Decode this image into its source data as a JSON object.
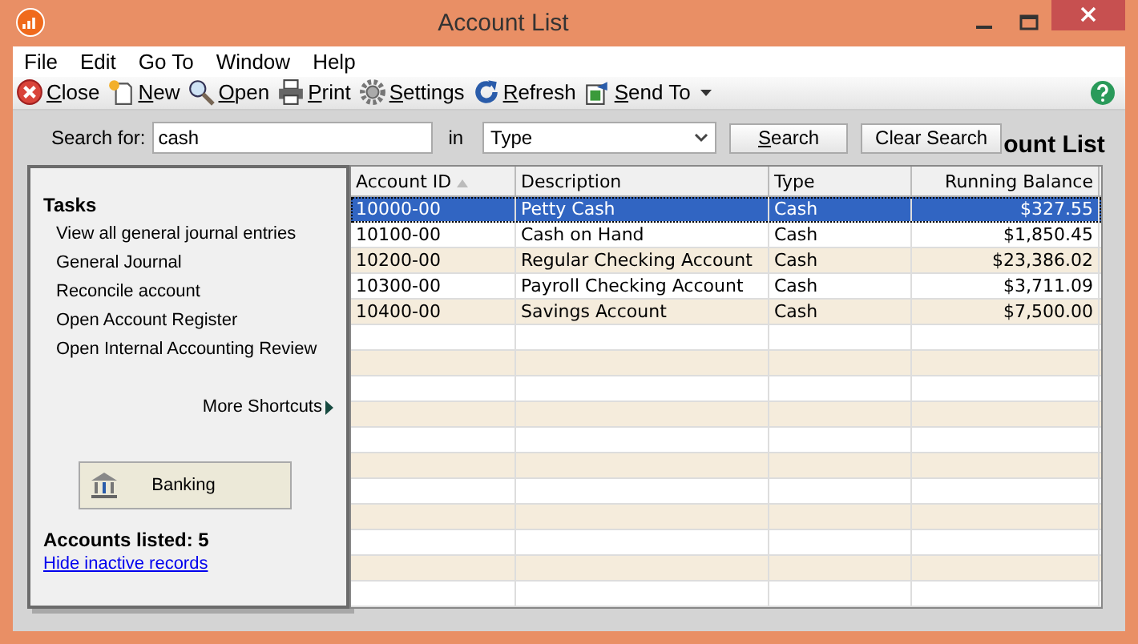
{
  "window": {
    "title": "Account List"
  },
  "menu": [
    "File",
    "Edit",
    "Go To",
    "Window",
    "Help"
  ],
  "toolbar": [
    "Close",
    "New",
    "Open",
    "Print",
    "Settings",
    "Refresh",
    "Send To"
  ],
  "search": {
    "label": "Search for:",
    "value": "cash",
    "in_label": "in",
    "field": "Type",
    "search_button": "Search",
    "clear_button": "Clear Search"
  },
  "heading": "ount List",
  "tasks": {
    "title": "Tasks",
    "items": [
      "View all general journal entries",
      "General Journal",
      "Reconcile account",
      "Open Account Register",
      "Open Internal Accounting Review"
    ],
    "more": "More Shortcuts",
    "banking": "Banking",
    "count": "Accounts listed: 5",
    "link": "Hide inactive records"
  },
  "table": {
    "columns": [
      "Account ID",
      "Description",
      "Type",
      "Running Balance"
    ],
    "rows": [
      {
        "cells": [
          "10000-00",
          "Petty Cash",
          "Cash",
          "$327.55"
        ],
        "selected": true
      },
      {
        "cells": [
          "10100-00",
          "Cash on Hand",
          "Cash",
          "$1,850.45"
        ],
        "selected": false
      },
      {
        "cells": [
          "10200-00",
          "Regular Checking Account",
          "Cash",
          "$23,386.02"
        ],
        "selected": false
      },
      {
        "cells": [
          "10300-00",
          "Payroll Checking Account",
          "Cash",
          "$3,711.09"
        ],
        "selected": false
      },
      {
        "cells": [
          "10400-00",
          "Savings Account",
          "Cash",
          "$7,500.00"
        ],
        "selected": false
      }
    ]
  }
}
